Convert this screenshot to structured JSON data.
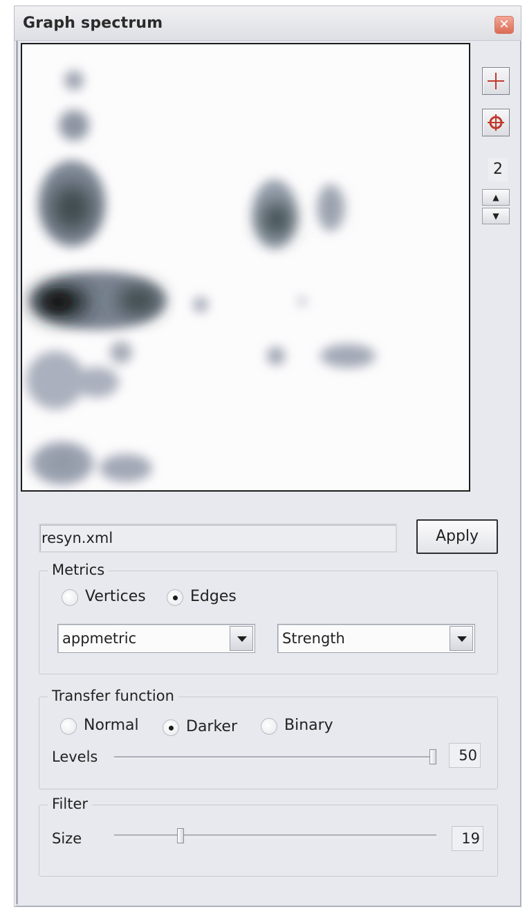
{
  "window": {
    "title": "Graph spectrum",
    "close_glyph": "✕"
  },
  "toolbar": {
    "crosshair_icon": "crosshair-icon",
    "target_icon": "target-icon",
    "counter": "2",
    "spin_up": "▲",
    "spin_down": "▼"
  },
  "file": {
    "value": "resyn.xml",
    "apply_label": "Apply"
  },
  "metrics": {
    "label": "Metrics",
    "options": [
      "Vertices",
      "Edges"
    ],
    "selected": "Edges",
    "metric_select": "appmetric",
    "property_select": "Strength"
  },
  "transfer": {
    "label": "Transfer  function",
    "options": [
      "Normal",
      "Darker",
      "Binary"
    ],
    "selected": "Darker",
    "levels_label": "Levels",
    "levels_value": "50",
    "levels_fraction": 1.0
  },
  "filter": {
    "label": "Filter",
    "size_label": "Size",
    "size_value": "19",
    "size_fraction": 0.2
  },
  "colors": {
    "accent": "#c0392b",
    "blob_dark": "#1a1a1a",
    "blob_light": "#9aa0b0"
  }
}
